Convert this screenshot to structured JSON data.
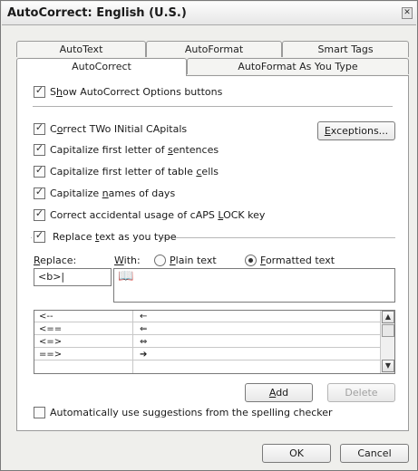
{
  "window": {
    "title": "AutoCorrect: English (U.S.)",
    "close_glyph": "✕"
  },
  "tabs_top": [
    "AutoText",
    "AutoFormat",
    "Smart Tags"
  ],
  "tabs_bottom": [
    "AutoCorrect",
    "AutoFormat As You Type"
  ],
  "options": {
    "show_buttons": {
      "pre": "S",
      "acc": "h",
      "post": "ow AutoCorrect Options buttons",
      "checked": true
    },
    "two_initial": {
      "pre": "C",
      "acc": "o",
      "post": "rrect TWo INitial CApitals",
      "checked": true
    },
    "first_sentence": {
      "pre": "Capitalize first letter of ",
      "acc": "s",
      "post": "entences",
      "checked": true
    },
    "table_cells": {
      "pre": "Capitalize first letter of table ",
      "acc": "c",
      "post": "ells",
      "checked": true
    },
    "names_days": {
      "pre": "Capitalize ",
      "acc": "n",
      "post": "ames of days",
      "checked": true
    },
    "caps_lock": {
      "pre": "Correct accidental usage of cAPS ",
      "acc": "L",
      "post": "OCK key",
      "checked": true
    },
    "replace_text": {
      "pre": "Replace ",
      "acc": "t",
      "post": "ext as you type",
      "checked": true
    },
    "suggestions": {
      "pre": "Automatically use su",
      "acc": "g",
      "post": "gestions from the spelling checker",
      "checked": false
    }
  },
  "exceptions_button": {
    "pre": "",
    "acc": "E",
    "post": "xceptions..."
  },
  "replace": {
    "replace_label": {
      "pre": "",
      "acc": "R",
      "post": "eplace:"
    },
    "with_label": {
      "pre": "",
      "acc": "W",
      "post": "ith:"
    },
    "plain_text": {
      "pre": "",
      "acc": "P",
      "post": "lain text",
      "selected": false
    },
    "formatted_text": {
      "pre": "",
      "acc": "F",
      "post": "ormatted text",
      "selected": true
    },
    "replace_value": "<b>|",
    "with_value": "📖"
  },
  "entries": [
    {
      "replace": "<--",
      "with": "←"
    },
    {
      "replace": "<==",
      "with": "⇐"
    },
    {
      "replace": "<=>",
      "with": "⇔"
    },
    {
      "replace": "==>",
      "with": "➔"
    }
  ],
  "buttons": {
    "add": {
      "pre": "",
      "acc": "A",
      "post": "dd"
    },
    "delete": "Delete",
    "ok": "OK",
    "cancel": "Cancel"
  },
  "check_glyph": "✓",
  "scroll_up_glyph": "▲",
  "scroll_down_glyph": "▼"
}
